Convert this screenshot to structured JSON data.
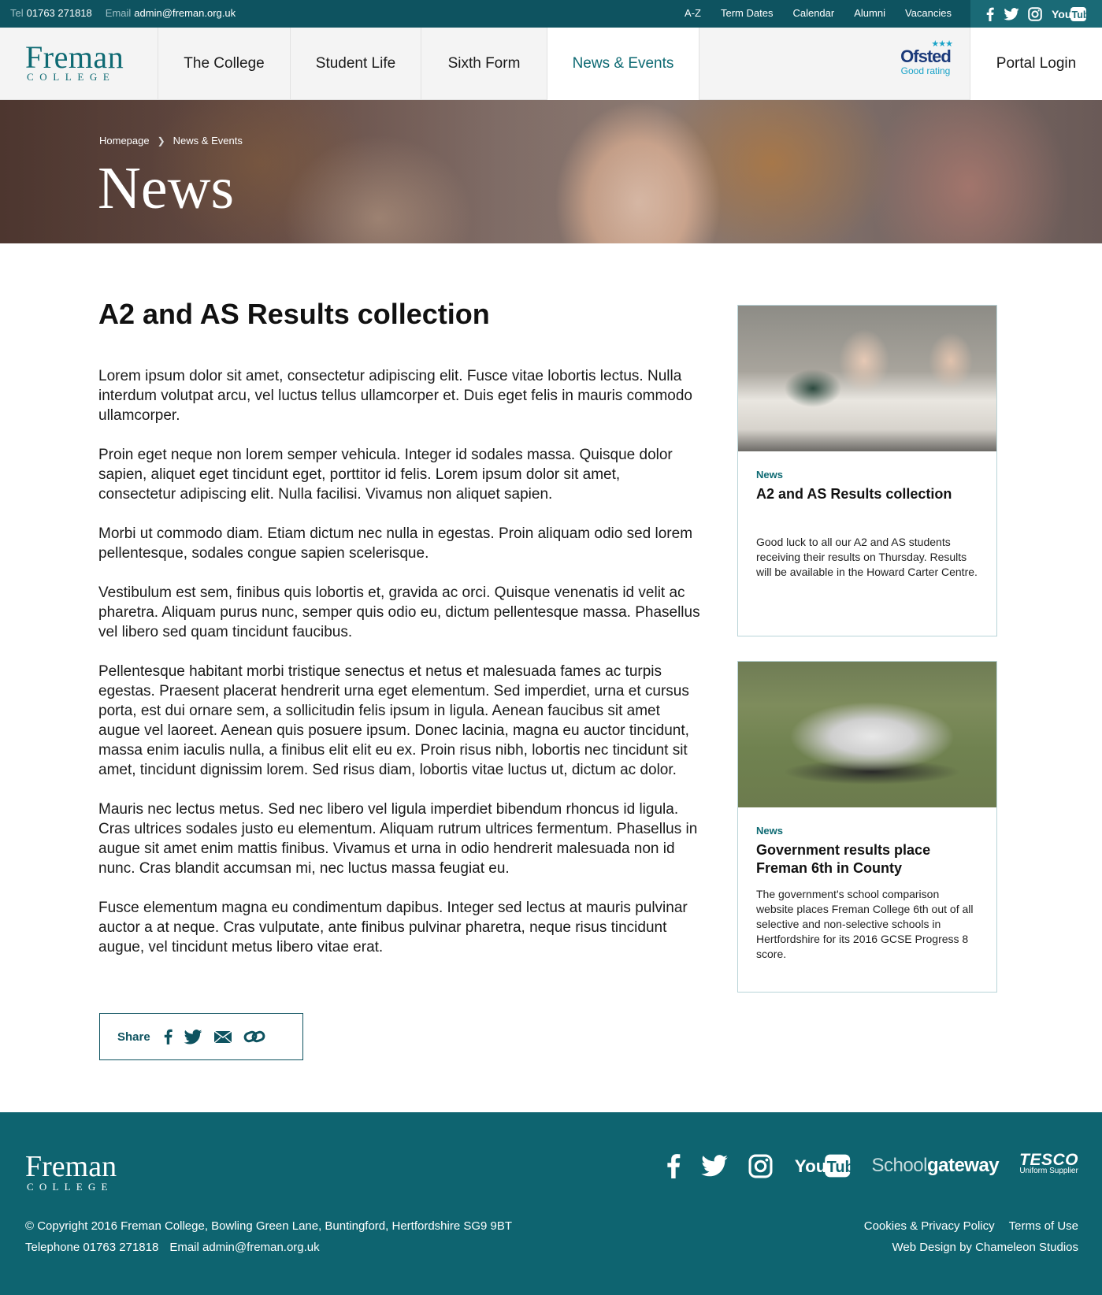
{
  "topbar": {
    "tel_label": "Tel",
    "tel_value": "01763 271818",
    "email_label": "Email",
    "email_value": "admin@freman.org.uk",
    "links": [
      "A-Z",
      "Term Dates",
      "Calendar",
      "Alumni",
      "Vacancies"
    ],
    "social_icons": [
      "facebook-icon",
      "twitter-icon",
      "instagram-icon",
      "youtube-icon"
    ],
    "youtube_text": "YouTube",
    "background": "#0e5360"
  },
  "logo": {
    "line1": "Freman",
    "line2": "COLLEGE"
  },
  "nav": {
    "items": [
      "The College",
      "Student Life",
      "Sixth Form",
      "News & Events"
    ],
    "active_item": "News & Events",
    "accent_color": "#0e6a73"
  },
  "ofsted": {
    "name": "Ofsted",
    "rating": "Good rating"
  },
  "portal": {
    "label": "Portal Login"
  },
  "hero": {
    "breadcrumb": [
      "Homepage",
      "News & Events"
    ],
    "title": "News"
  },
  "article": {
    "title": "A2 and AS Results collection",
    "paragraphs": [
      "Lorem ipsum dolor sit amet, consectetur adipiscing elit. Fusce vitae lobortis lectus. Nulla interdum volutpat arcu, vel luctus tellus ullamcorper et. Duis eget felis in mauris commodo ullamcorper.",
      "Proin eget neque non lorem semper vehicula. Integer id sodales massa. Quisque dolor sapien, aliquet eget tincidunt eget, porttitor id felis. Lorem ipsum dolor sit amet, consectetur adipiscing elit. Nulla facilisi. Vivamus non aliquet sapien.",
      "Morbi ut commodo diam. Etiam dictum nec nulla in egestas. Proin aliquam odio sed lorem pellentesque, sodales congue sapien scelerisque.",
      "Vestibulum est sem, finibus quis lobortis et, gravida ac orci. Quisque venenatis id velit ac pharetra. Aliquam purus nunc, semper quis odio eu, dictum pellentesque massa. Phasellus vel libero sed quam tincidunt faucibus.",
      "Pellentesque habitant morbi tristique senectus et netus et malesuada fames ac turpis egestas. Praesent placerat hendrerit urna eget elementum. Sed imperdiet, urna et cursus porta, est dui ornare sem, a sollicitudin felis ipsum in ligula. Aenean faucibus sit amet augue vel laoreet. Aenean quis posuere ipsum. Donec lacinia, magna eu auctor tincidunt, massa enim iaculis nulla, a finibus elit elit eu ex. Proin risus nibh, lobortis nec tincidunt sit amet, tincidunt dignissim lorem. Sed risus diam, lobortis vitae luctus ut, dictum ac dolor.",
      "Mauris nec lectus metus. Sed nec libero vel ligula imperdiet bibendum rhoncus id ligula. Cras ultrices sodales justo eu elementum. Aliquam rutrum ultrices fermentum. Phasellus in augue sit amet enim mattis finibus. Vivamus et urna in odio hendrerit malesuada non id nunc. Cras blandit accumsan mi, nec luctus massa feugiat eu.",
      "Fusce elementum magna eu condimentum dapibus. Integer sed lectus at mauris pulvinar auctor a at neque. Cras vulputate, ante finibus pulvinar pharetra, neque risus tincidunt augue, vel tincidunt metus libero vitae erat."
    ],
    "share": {
      "label": "Share",
      "icons": [
        "facebook-icon",
        "twitter-icon",
        "email-icon",
        "link-icon"
      ]
    }
  },
  "sidebar": {
    "cards": [
      {
        "category": "News",
        "title": "A2 and AS Results collection",
        "text": "Good luck to all our A2 and AS students receiving their results on Thursday. Results will be available in the Howard Carter Centre."
      },
      {
        "category": "News",
        "title": "Government results place Freman 6th in County",
        "text": "The government's school comparison website places Freman College 6th out of all selective and non-selective schools in Hertfordshire for its 2016 GCSE Progress 8 score."
      }
    ]
  },
  "footer": {
    "logo": {
      "line1": "Freman",
      "line2": "COLLEGE"
    },
    "social_icons": [
      "facebook-icon",
      "twitter-icon",
      "instagram-icon",
      "youtube-icon"
    ],
    "youtube_text": "YouTube",
    "schoolgateway": {
      "part1": "Sch",
      "part2": "ool",
      "part3": "gateway"
    },
    "tesco": {
      "name": "TESCO",
      "sub": "Uniform Supplier"
    },
    "copyright": "© Copyright 2016 Freman College, Bowling Green Lane, Buntingford, Hertfordshire SG9 9BT",
    "telephone": "Telephone 01763 271818",
    "email": "Email admin@freman.org.uk",
    "cookies": "Cookies & Privacy Policy",
    "terms": "Terms of Use",
    "credit": "Web Design by Chameleon Studios",
    "background": "#0e6470"
  }
}
